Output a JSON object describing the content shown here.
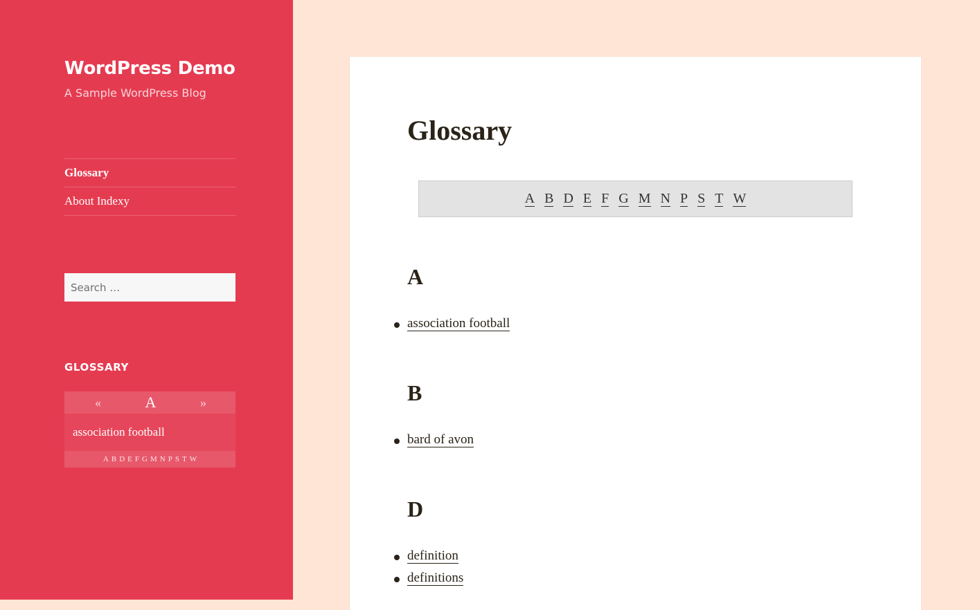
{
  "site": {
    "title": "WordPress Demo",
    "description": "A Sample WordPress Blog"
  },
  "nav": {
    "items": [
      {
        "label": "Glossary"
      },
      {
        "label": "About Indexy"
      }
    ]
  },
  "search": {
    "placeholder": "Search …"
  },
  "glossary_widget": {
    "title": "GLOSSARY",
    "prev": "«",
    "next": "»",
    "current_letter": "A",
    "term": "association football",
    "letters": [
      "A",
      "B",
      "D",
      "E",
      "F",
      "G",
      "M",
      "N",
      "P",
      "S",
      "T",
      "W"
    ]
  },
  "page": {
    "title": "Glossary",
    "alphabet": [
      "A",
      "B",
      "D",
      "E",
      "F",
      "G",
      "M",
      "N",
      "P",
      "S",
      "T",
      "W"
    ],
    "sections": [
      {
        "letter": "A",
        "terms": [
          "association football"
        ]
      },
      {
        "letter": "B",
        "terms": [
          "bard of avon"
        ]
      },
      {
        "letter": "D",
        "terms": [
          "definition",
          "definitions"
        ]
      }
    ]
  },
  "colors": {
    "sidebar": "#e53b51",
    "background": "#ffe5d5",
    "content": "#ffffff"
  }
}
